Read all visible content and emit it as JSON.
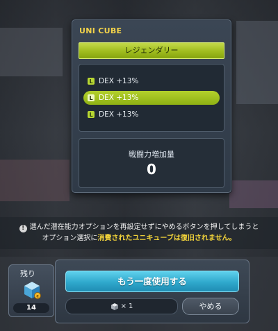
{
  "panel": {
    "title": "UNI CUBE",
    "rank": "レジェンダリー",
    "options": [
      {
        "badge": "L",
        "text": "DEX +13%",
        "selected": false
      },
      {
        "badge": "L",
        "text": "DEX +13%",
        "selected": true
      },
      {
        "badge": "L",
        "text": "DEX +13%",
        "selected": false
      }
    ],
    "power_label": "戦闘力増加量",
    "power_value": "0"
  },
  "notice": {
    "icon": "!",
    "line1": "選んだ潜在能力オプションを再設定せずにやめるボタンを押してしまうと",
    "line2_pre": "オプション選択に",
    "line2_hl1": "消費された",
    "line2_hl2": "ユニキューブは復旧されません。"
  },
  "remaining": {
    "label": "残り",
    "count": "14",
    "icon": "uni-cube-icon"
  },
  "actions": {
    "reuse_label": "もう一度使用する",
    "cost_prefix": "×",
    "cost_value": "1",
    "cost_icon": "cube-icon",
    "cancel_label": "やめる"
  },
  "colors": {
    "title": "#f2d24a",
    "rank_bar": "#9fbc1e",
    "selected_row": "#a2c11f",
    "reuse_button": "#2fa8cc",
    "highlight_text": "#f2d33a"
  }
}
